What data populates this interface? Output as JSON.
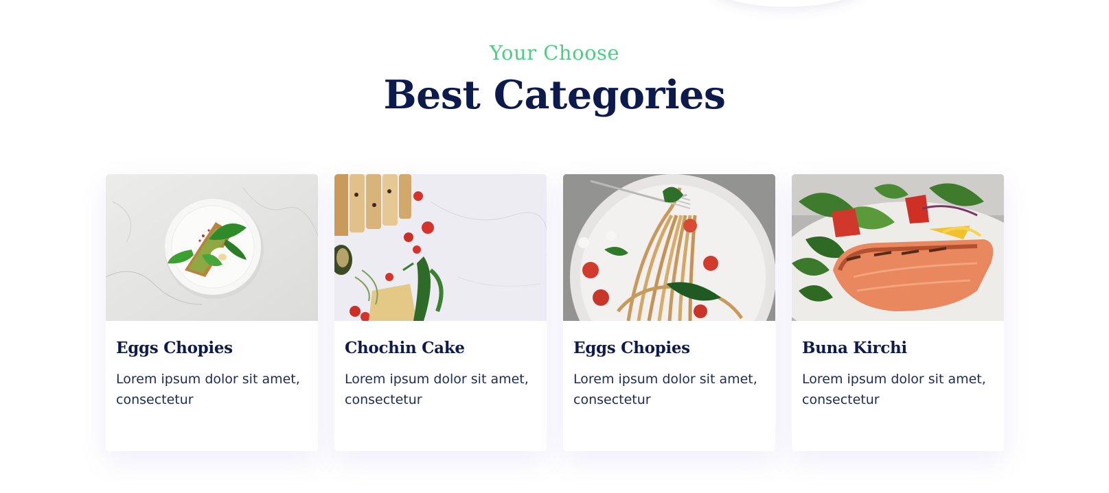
{
  "section": {
    "eyebrow": "Your Choose",
    "title": "Best Categories"
  },
  "cards": [
    {
      "title": "Eggs Chopies",
      "description": "Lorem ipsum dolor sit amet, consectetur",
      "image_icon": "avocado-toast-plate-image"
    },
    {
      "title": "Chochin Cake",
      "description": "Lorem ipsum dolor sit amet, consectetur",
      "image_icon": "bread-vegetables-image"
    },
    {
      "title": "Eggs Chopies",
      "description": "Lorem ipsum dolor sit amet, consectetur",
      "image_icon": "spaghetti-fork-image"
    },
    {
      "title": "Buna Kirchi",
      "description": "Lorem ipsum dolor sit amet, consectetur",
      "image_icon": "grilled-salmon-salad-image"
    }
  ],
  "colors": {
    "accent_green": "#4ccf82",
    "heading_navy": "#0d1b4c",
    "body_text": "#1c2a55"
  }
}
